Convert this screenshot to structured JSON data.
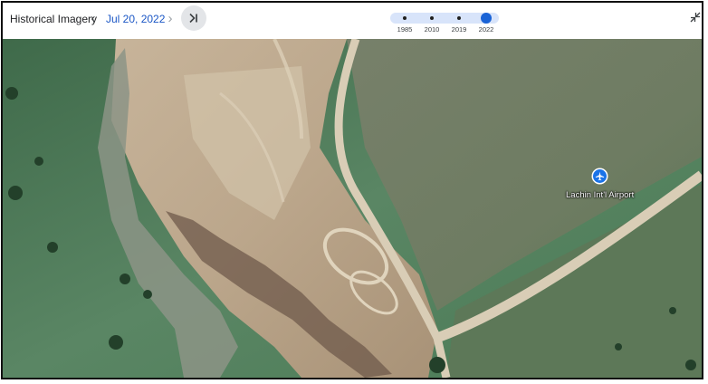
{
  "toolbar": {
    "title": "Historical Imagery",
    "prev_icon": "chevron-left-icon",
    "prev_glyph": "‹",
    "date": "Jul 20, 2022",
    "next_icon": "chevron-right-icon",
    "next_glyph": "›",
    "jump_icon": "skip-to-latest-icon",
    "collapse_icon": "collapse-icon"
  },
  "timeline": {
    "ticks": [
      {
        "label": "1985"
      },
      {
        "label": "2010"
      },
      {
        "label": "2019"
      },
      {
        "label": "2022"
      }
    ],
    "selected": "2022",
    "track_color": "#d8e4fa",
    "active_color": "#1a63d6"
  },
  "map": {
    "airport_label": "Lachin Int'l Airport",
    "airport_icon": "airplane-icon",
    "pin_color": "#1a73e8"
  }
}
